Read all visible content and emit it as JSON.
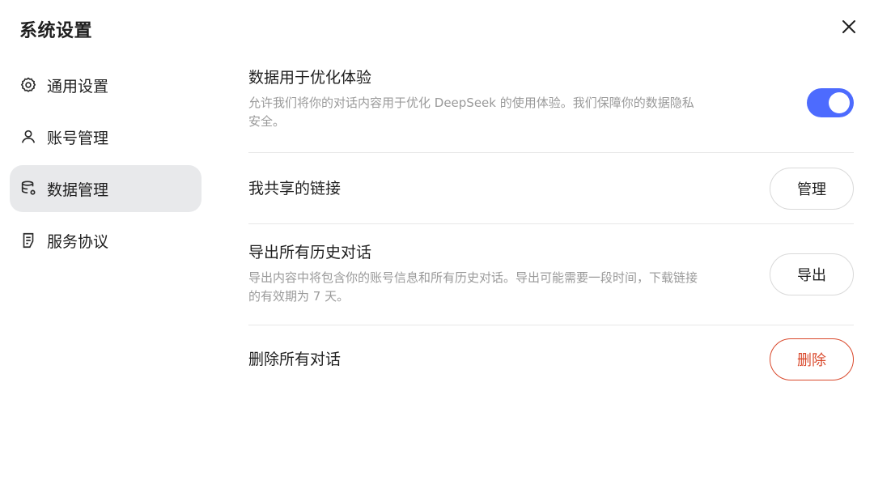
{
  "header": {
    "title": "系统设置",
    "close_icon": "close-icon"
  },
  "sidebar": {
    "items": [
      {
        "label": "通用设置",
        "icon": "gear-icon"
      },
      {
        "label": "账号管理",
        "icon": "user-icon"
      },
      {
        "label": "数据管理",
        "icon": "database-icon",
        "active": true
      },
      {
        "label": "服务协议",
        "icon": "document-icon"
      }
    ]
  },
  "content": {
    "optimize": {
      "title": "数据用于优化体验",
      "description": "允许我们将你的对话内容用于优化 DeepSeek 的使用体验。我们保障你的数据隐私安全。",
      "toggle_on": true,
      "toggle_color": "#4d6bfe"
    },
    "shared_links": {
      "title": "我共享的链接",
      "button_label": "管理"
    },
    "export": {
      "title": "导出所有历史对话",
      "description": "导出内容中将包含你的账号信息和所有历史对话。导出可能需要一段时间，下载链接的有效期为 7 天。",
      "button_label": "导出"
    },
    "delete": {
      "title": "删除所有对话",
      "button_label": "删除",
      "danger_color": "#d9482b"
    }
  }
}
